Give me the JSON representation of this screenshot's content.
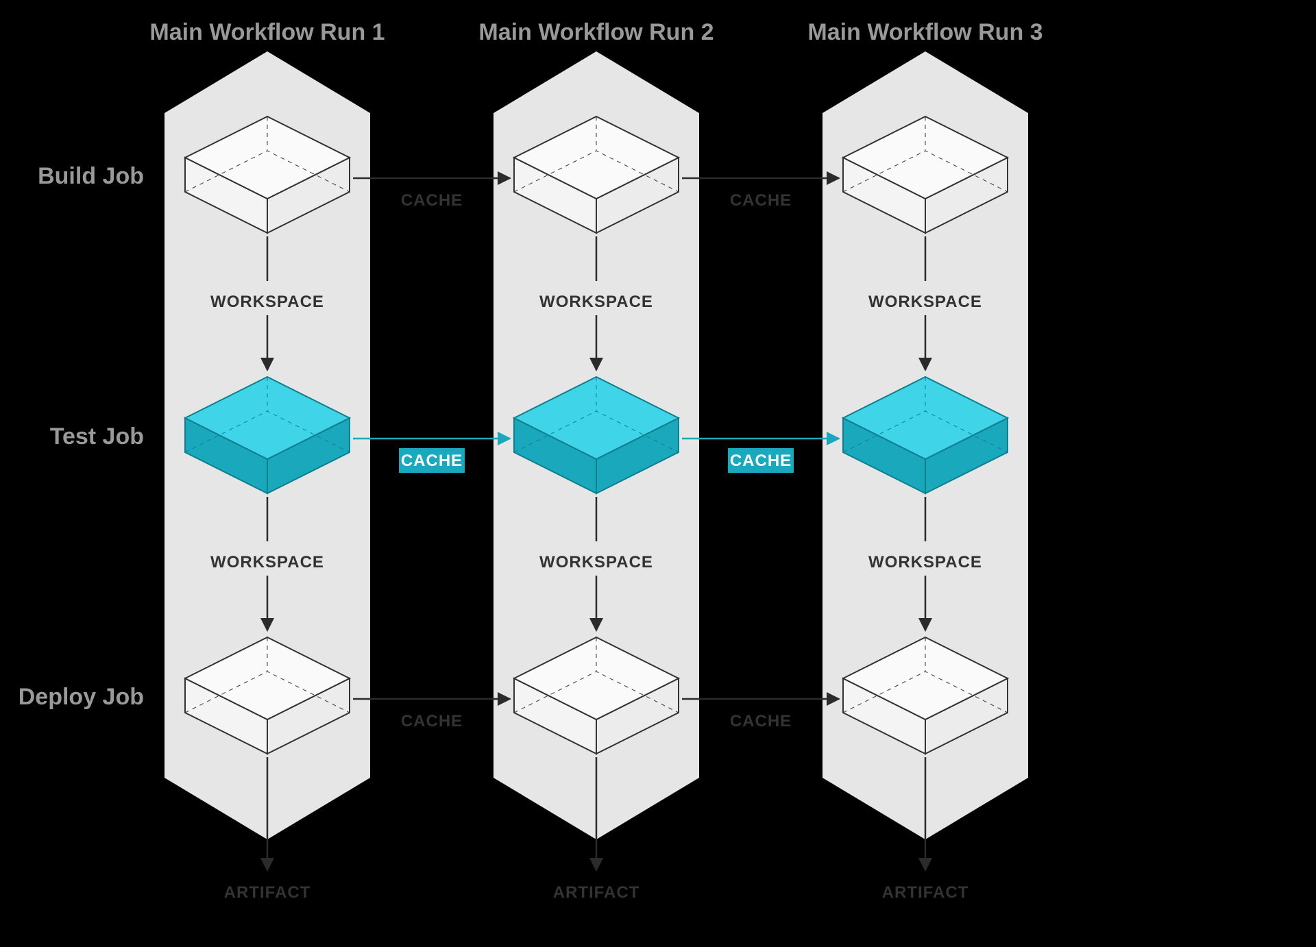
{
  "columns": [
    {
      "title": "Main Workflow Run 1"
    },
    {
      "title": "Main Workflow Run 2"
    },
    {
      "title": "Main Workflow Run 3"
    }
  ],
  "rows": [
    {
      "title": "Build Job"
    },
    {
      "title": "Test Job"
    },
    {
      "title": "Deploy Job"
    }
  ],
  "labels": {
    "workspace": "WORKSPACE",
    "cache": "CACHE",
    "artifact": "ARTIFACT"
  },
  "colors": {
    "panel": "#e6e6e6",
    "boxStroke": "#333333",
    "testFill": "#27c3d9",
    "testSide": "#19a8bc",
    "arrow": "#2b2b2b",
    "arrowTeal": "#19a8bc",
    "badge": "#19a8bc"
  },
  "diagram": {
    "description": "Three workflow runs (columns), each containing three jobs (Build, Test, Deploy) stacked vertically. Within a run, jobs pass data via WORKSPACE. Between runs, each job's cache flows to the same job in the next run. Test-job caches are highlighted teal. Each run's Deploy Job outputs an ARTIFACT.",
    "vertical_flow_label": "WORKSPACE",
    "horizontal_flow_label": "CACHE",
    "output_label": "ARTIFACT",
    "highlighted_row_index": 1
  }
}
